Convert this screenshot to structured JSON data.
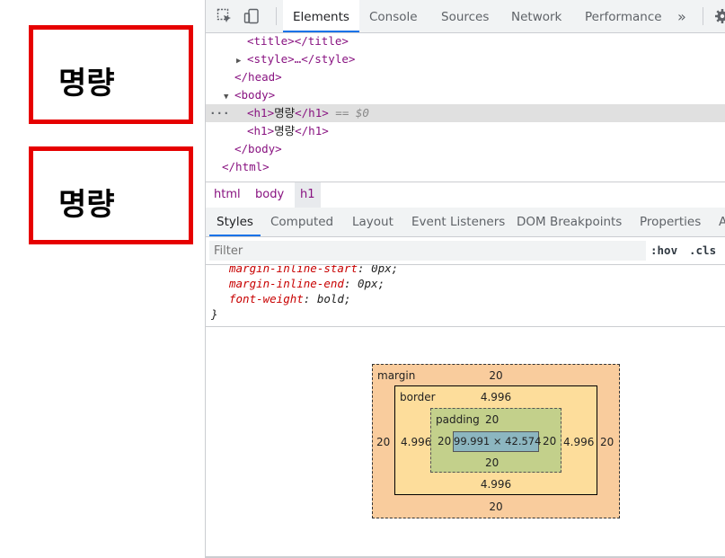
{
  "page": {
    "headings": [
      {
        "text": "명량"
      },
      {
        "text": "명량"
      }
    ]
  },
  "devtools": {
    "main_tabs": [
      {
        "label": "Elements"
      },
      {
        "label": "Console"
      },
      {
        "label": "Sources"
      },
      {
        "label": "Network"
      },
      {
        "label": "Performance"
      }
    ],
    "more_tabs_icon": "»",
    "elements": {
      "lines": [
        {
          "text_open": "<title>",
          "text_close": "</title>"
        },
        {
          "text": "<style>…</style>"
        },
        {
          "text": "</head>"
        },
        {
          "text": "<body>"
        },
        {
          "text_open": "<h1>",
          "content": "명량",
          "text_close": "</h1>",
          "suffix": " == $0",
          "dots": "···"
        },
        {
          "text_open": "<h1>",
          "content": "명량",
          "text_close": "</h1>"
        },
        {
          "text": "</body>"
        },
        {
          "text": "</html>"
        }
      ]
    },
    "breadcrumbs": [
      "html",
      "body",
      "h1"
    ],
    "sub_tabs": [
      {
        "label": "Styles"
      },
      {
        "label": "Computed"
      },
      {
        "label": "Layout"
      },
      {
        "label": "Event Listeners"
      },
      {
        "label": "DOM Breakpoints"
      },
      {
        "label": "Properties"
      },
      {
        "label": "A"
      }
    ],
    "filter": {
      "placeholder": "Filter",
      "hov": ":hov",
      "cls": ".cls"
    },
    "styles": {
      "props": [
        {
          "name": "margin-inline-start",
          "value": "0px;"
        },
        {
          "name": "margin-inline-end",
          "value": "0px;"
        },
        {
          "name": "font-weight",
          "value": "bold;"
        }
      ],
      "close_brace": "}"
    },
    "box_model": {
      "margin_label": "margin",
      "border_label": "border",
      "padding_label": "padding",
      "margin": {
        "top": "20",
        "right": "20",
        "bottom": "20",
        "left": "20"
      },
      "border": {
        "top": "4.996",
        "right": "4.996",
        "bottom": "4.996",
        "left": "4.996"
      },
      "padding": {
        "top": "20",
        "right": "20",
        "bottom": "20",
        "left": "20"
      },
      "content": "99.991 × 42.574",
      "colors": {
        "margin": "#f9cc9d",
        "border": "#fddd9b",
        "padding": "#c3d08b",
        "content": "#8cb6c0"
      }
    }
  }
}
